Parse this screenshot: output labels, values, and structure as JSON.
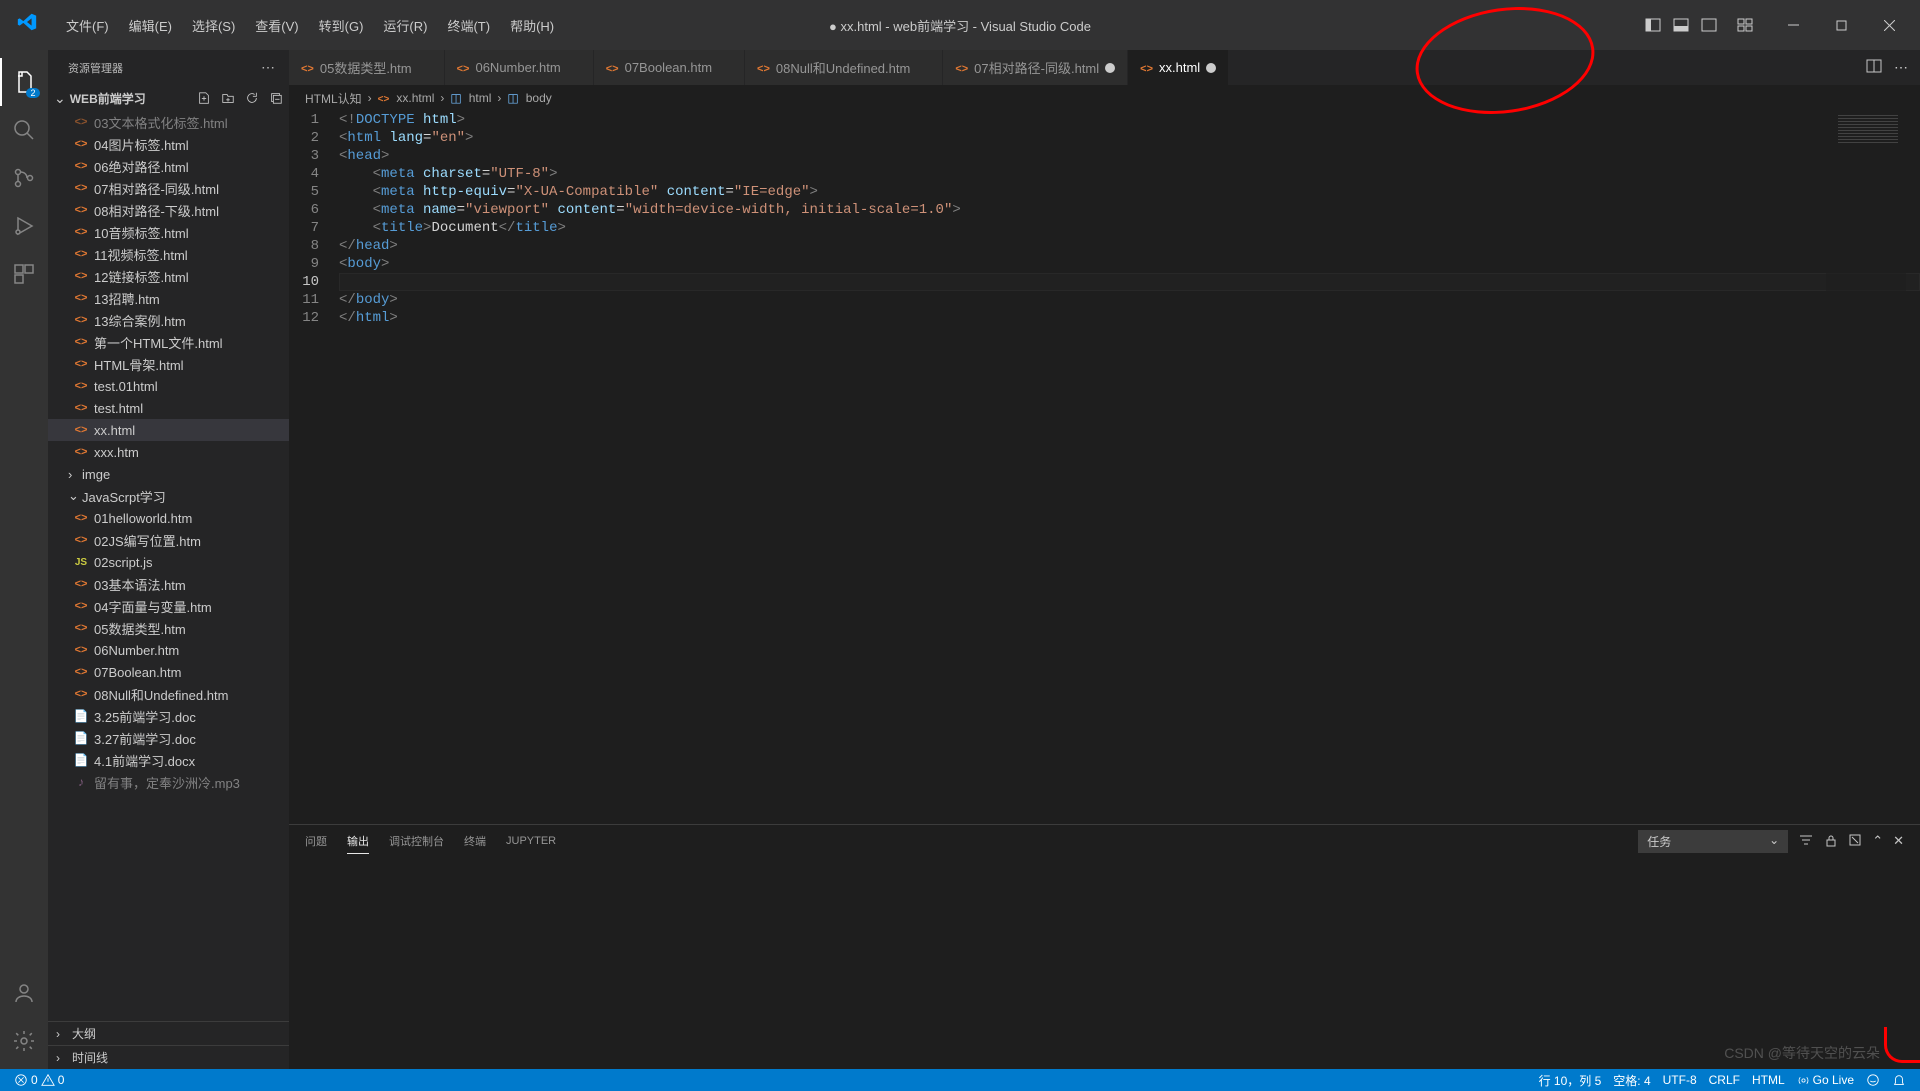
{
  "title": "● xx.html - web前端学习 - Visual Studio Code",
  "menu": [
    "文件(F)",
    "编辑(E)",
    "选择(S)",
    "查看(V)",
    "转到(G)",
    "运行(R)",
    "终端(T)",
    "帮助(H)"
  ],
  "explorer": {
    "title": "资源管理器",
    "folder": "WEB前端学习",
    "items": [
      {
        "label": "03文本格式化标签.html",
        "icon": "html",
        "kind": "file",
        "indent": 1,
        "cut": true
      },
      {
        "label": "04图片标签.html",
        "icon": "html",
        "kind": "file",
        "indent": 1
      },
      {
        "label": "06绝对路径.html",
        "icon": "html",
        "kind": "file",
        "indent": 1
      },
      {
        "label": "07相对路径-同级.html",
        "icon": "html",
        "kind": "file",
        "indent": 1
      },
      {
        "label": "08相对路径-下级.html",
        "icon": "html",
        "kind": "file",
        "indent": 1
      },
      {
        "label": "10音频标签.html",
        "icon": "html",
        "kind": "file",
        "indent": 1
      },
      {
        "label": "11视频标签.html",
        "icon": "html",
        "kind": "file",
        "indent": 1
      },
      {
        "label": "12链接标签.html",
        "icon": "html",
        "kind": "file",
        "indent": 1
      },
      {
        "label": "13招聘.htm",
        "icon": "html",
        "kind": "file",
        "indent": 1
      },
      {
        "label": "13综合案例.htm",
        "icon": "html",
        "kind": "file",
        "indent": 1
      },
      {
        "label": "第一个HTML文件.html",
        "icon": "html",
        "kind": "file",
        "indent": 1
      },
      {
        "label": "HTML骨架.html",
        "icon": "html",
        "kind": "file",
        "indent": 1
      },
      {
        "label": "test.01html",
        "icon": "html",
        "kind": "file",
        "indent": 1
      },
      {
        "label": "test.html",
        "icon": "html",
        "kind": "file",
        "indent": 1
      },
      {
        "label": "xx.html",
        "icon": "html",
        "kind": "file",
        "indent": 1,
        "selected": true
      },
      {
        "label": "xxx.htm",
        "icon": "html",
        "kind": "file",
        "indent": 1
      },
      {
        "label": "imge",
        "icon": "folder",
        "kind": "folder",
        "indent": 1,
        "open": false
      },
      {
        "label": "JavaScrpt学习",
        "icon": "folder",
        "kind": "folder",
        "indent": 1,
        "open": true
      },
      {
        "label": "01helloworld.htm",
        "icon": "html",
        "kind": "file",
        "indent": 1
      },
      {
        "label": "02JS编写位置.htm",
        "icon": "html",
        "kind": "file",
        "indent": 1
      },
      {
        "label": "02script.js",
        "icon": "js",
        "kind": "file",
        "indent": 1
      },
      {
        "label": "03基本语法.htm",
        "icon": "html",
        "kind": "file",
        "indent": 1
      },
      {
        "label": "04字面量与变量.htm",
        "icon": "html",
        "kind": "file",
        "indent": 1
      },
      {
        "label": "05数据类型.htm",
        "icon": "html",
        "kind": "file",
        "indent": 1
      },
      {
        "label": "06Number.htm",
        "icon": "html",
        "kind": "file",
        "indent": 1
      },
      {
        "label": "07Boolean.htm",
        "icon": "html",
        "kind": "file",
        "indent": 1
      },
      {
        "label": "08Null和Undefined.htm",
        "icon": "html",
        "kind": "file",
        "indent": 1
      },
      {
        "label": "3.25前端学习.doc",
        "icon": "doc",
        "kind": "file",
        "indent": 0
      },
      {
        "label": "3.27前端学习.doc",
        "icon": "doc",
        "kind": "file",
        "indent": 0
      },
      {
        "label": "4.1前端学习.docx",
        "icon": "doc",
        "kind": "file",
        "indent": 0
      },
      {
        "label": "留有事，定奉沙洲冷.mp3",
        "icon": "audio",
        "kind": "file",
        "indent": 0,
        "cut": true
      }
    ],
    "outline": "大纲",
    "timeline": "时间线"
  },
  "activity_badge": "2",
  "tabs": [
    {
      "label": "05数据类型.htm",
      "dirty": false,
      "active": false
    },
    {
      "label": "06Number.htm",
      "dirty": false,
      "active": false
    },
    {
      "label": "07Boolean.htm",
      "dirty": false,
      "active": false
    },
    {
      "label": "08Null和Undefined.htm",
      "dirty": false,
      "active": false
    },
    {
      "label": "07相对路径-同级.html",
      "dirty": true,
      "active": false
    },
    {
      "label": "xx.html",
      "dirty": true,
      "active": true
    }
  ],
  "breadcrumb": {
    "p1": "HTML认知",
    "p2": "xx.html",
    "p3": "html",
    "p4": "body"
  },
  "code": {
    "lines": [
      {
        "n": "1",
        "html": "<span class='p-grey'>&lt;!</span><span class='p-blue'>DOCTYPE</span> <span class='p-lblue'>html</span><span class='p-grey'>&gt;</span>"
      },
      {
        "n": "2",
        "html": "<span class='p-grey'>&lt;</span><span class='p-blue'>html</span> <span class='p-lblue'>lang</span><span class='p-white'>=</span><span class='p-orange'>\"en\"</span><span class='p-grey'>&gt;</span>"
      },
      {
        "n": "3",
        "html": "<span class='p-grey'>&lt;</span><span class='p-blue'>head</span><span class='p-grey'>&gt;</span>"
      },
      {
        "n": "4",
        "html": "    <span class='p-grey'>&lt;</span><span class='p-blue'>meta</span> <span class='p-lblue'>charset</span><span class='p-white'>=</span><span class='p-orange'>\"UTF-8\"</span><span class='p-grey'>&gt;</span>"
      },
      {
        "n": "5",
        "html": "    <span class='p-grey'>&lt;</span><span class='p-blue'>meta</span> <span class='p-lblue'>http-equiv</span><span class='p-white'>=</span><span class='p-orange'>\"X-UA-Compatible\"</span> <span class='p-lblue'>content</span><span class='p-white'>=</span><span class='p-orange'>\"IE=edge\"</span><span class='p-grey'>&gt;</span>"
      },
      {
        "n": "6",
        "html": "    <span class='p-grey'>&lt;</span><span class='p-blue'>meta</span> <span class='p-lblue'>name</span><span class='p-white'>=</span><span class='p-orange'>\"viewport\"</span> <span class='p-lblue'>content</span><span class='p-white'>=</span><span class='p-orange'>\"width=device-width, initial-scale=1.0\"</span><span class='p-grey'>&gt;</span>"
      },
      {
        "n": "7",
        "html": "    <span class='p-grey'>&lt;</span><span class='p-blue'>title</span><span class='p-grey'>&gt;</span><span class='p-white'>Document</span><span class='p-grey'>&lt;/</span><span class='p-blue'>title</span><span class='p-grey'>&gt;</span>"
      },
      {
        "n": "8",
        "html": "<span class='p-grey'>&lt;/</span><span class='p-blue'>head</span><span class='p-grey'>&gt;</span>"
      },
      {
        "n": "9",
        "html": "<span class='p-grey'>&lt;</span><span class='p-blue'>body</span><span class='p-grey'>&gt;</span>"
      },
      {
        "n": "10",
        "html": "    ",
        "current": true
      },
      {
        "n": "11",
        "html": "<span class='p-grey'>&lt;/</span><span class='p-blue'>body</span><span class='p-grey'>&gt;</span>"
      },
      {
        "n": "12",
        "html": "<span class='p-grey'>&lt;/</span><span class='p-blue'>html</span><span class='p-grey'>&gt;</span>"
      }
    ]
  },
  "panel": {
    "tabs": [
      "问题",
      "输出",
      "调试控制台",
      "终端",
      "JUPYTER"
    ],
    "active_tab": 1,
    "filter": "任务"
  },
  "status": {
    "errors": "0",
    "warnings": "0",
    "line": "行 10，列 5",
    "spaces": "空格: 4",
    "enc": "UTF-8",
    "eol": "CRLF",
    "lang": "HTML",
    "live": "Go Live"
  },
  "watermark": "CSDN @等待天空的云朵"
}
